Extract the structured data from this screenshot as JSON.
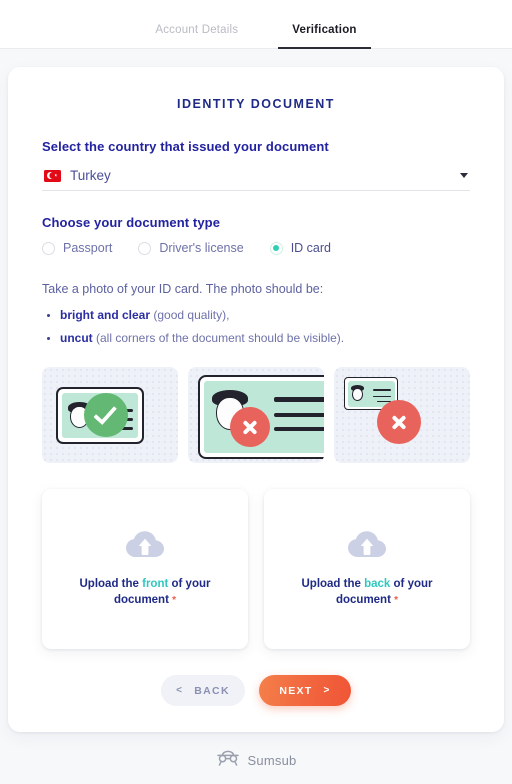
{
  "tabs": [
    {
      "label": "Account Details",
      "active": false
    },
    {
      "label": "Verification",
      "active": true
    }
  ],
  "form": {
    "title": "IDENTITY DOCUMENT",
    "country_label": "Select the country that issued your document",
    "country_value": "Turkey",
    "country_flag": "turkey-flag-icon",
    "doctype_label": "Choose your document type",
    "doctype_options": [
      {
        "label": "Passport",
        "selected": false
      },
      {
        "label": "Driver's license",
        "selected": false
      },
      {
        "label": "ID card",
        "selected": true
      }
    ],
    "instruction_lead": "Take a photo of your ID card. The photo should be:",
    "bullets": [
      {
        "strong": "bright and clear",
        "rest": " (good quality),"
      },
      {
        "strong": "uncut",
        "rest": " (all corners of the document should be visible)."
      }
    ]
  },
  "examples": [
    {
      "name": "example-good",
      "status": "ok",
      "icon": "check-circle-icon"
    },
    {
      "name": "example-too-close",
      "status": "bad",
      "icon": "cross-circle-icon"
    },
    {
      "name": "example-too-far",
      "status": "bad",
      "icon": "cross-circle-icon"
    }
  ],
  "uploads": [
    {
      "icon": "cloud-upload-icon",
      "prefix": "Upload the ",
      "side": "front",
      "suffix": " of your document ",
      "required_mark": "*"
    },
    {
      "icon": "cloud-upload-icon",
      "prefix": "Upload the ",
      "side": "back",
      "suffix": " of your document ",
      "required_mark": "*"
    }
  ],
  "buttons": {
    "back_label": "BACK",
    "back_chevron": "<",
    "next_label": "NEXT",
    "next_chevron": ">"
  },
  "footer": {
    "brand": "Sumsub",
    "logo_icon": "sumsub-mask-icon"
  },
  "colors": {
    "accent_teal": "#2fc8c0",
    "primary_navy": "#1f2a86",
    "required_red": "#f05a4f",
    "next_orange": "#ef5536",
    "ok_green": "#63b874",
    "bad_red": "#e8635c"
  }
}
